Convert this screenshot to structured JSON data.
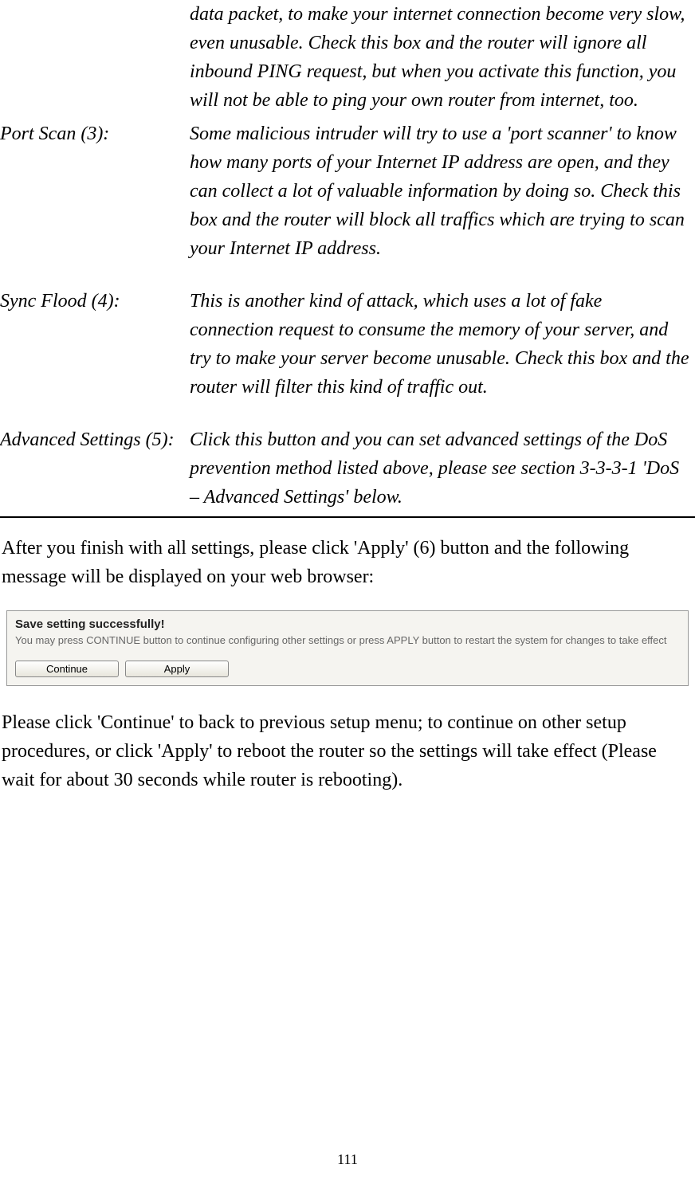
{
  "definitions": {
    "unlabeled_desc": "data packet, to make your internet connection become very slow, even unusable. Check this box and the router will ignore all inbound PING request, but when you activate this function, you will not be able to ping your own router from internet, too.",
    "port_scan_label": "Port Scan (3):",
    "port_scan_desc": "Some malicious intruder will try to use a 'port scanner' to know how many ports of your Internet IP address are open, and they can collect a lot of valuable information by doing so. Check this box and the router will block all traffics which are trying to scan your Internet IP address.",
    "sync_flood_label": "Sync Flood (4):",
    "sync_flood_desc": "This is another kind of attack, which uses a lot of fake connection request to consume the memory of your server, and try to make your server become unusable. Check this box and the router will filter this kind of traffic out.",
    "advanced_label": "Advanced Settings (5):",
    "advanced_desc": "Click this button and you can set advanced settings of the DoS prevention method listed above, please see section 3-3-3-1 'DoS – Advanced Settings' below."
  },
  "paragraph1": "After you finish with all settings, please click 'Apply' (6) button and the following message will be displayed on your web browser:",
  "dialog": {
    "title": "Save setting successfully!",
    "text": "You may press CONTINUE button to continue configuring other settings or press APPLY button to restart the system for changes to take effect",
    "continue_btn": "Continue",
    "apply_btn": "Apply"
  },
  "paragraph2": "Please click 'Continue' to back to previous setup menu; to continue on other setup procedures, or click 'Apply' to reboot the router so the settings will take effect (Please wait for about 30 seconds while router is rebooting).",
  "page_number": "111"
}
